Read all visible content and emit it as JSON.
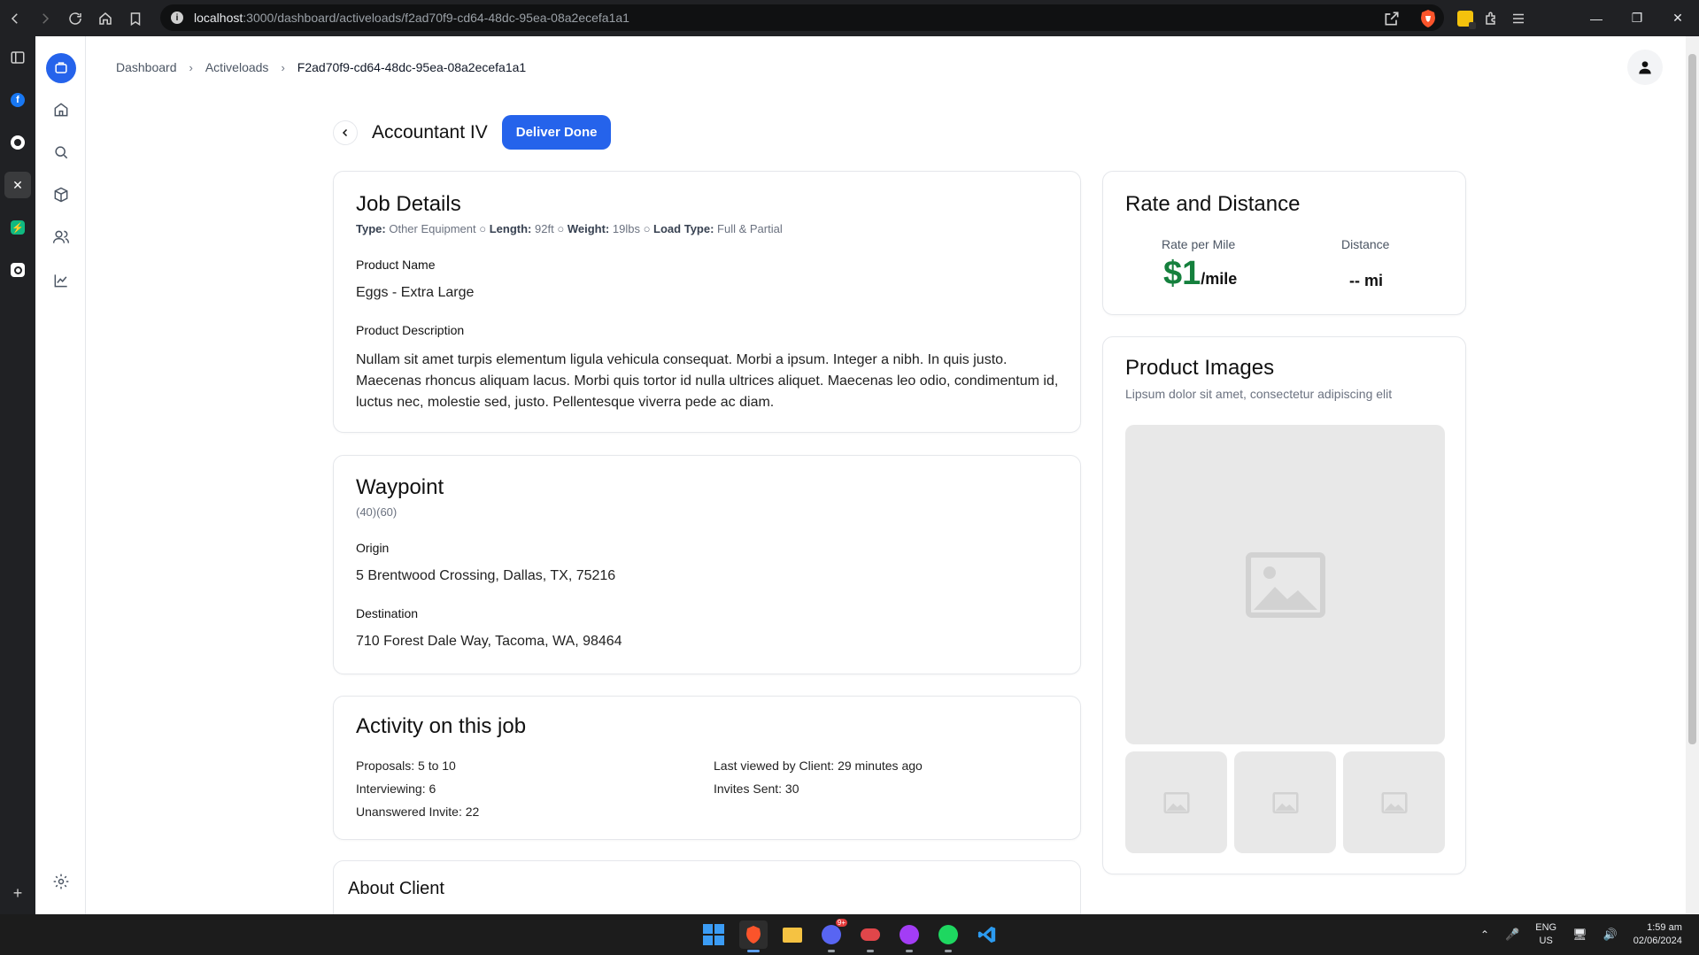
{
  "browser": {
    "url_host": "localhost",
    "url_path": ":3000/dashboard/activeloads/f2ad70f9-cd64-48dc-95ea-08a2ecefa1a1"
  },
  "breadcrumb": {
    "items": [
      "Dashboard",
      "Activeloads",
      "F2ad70f9-cd64-48dc-95ea-08a2ecefa1a1"
    ]
  },
  "header": {
    "title": "Accountant IV",
    "deliver_label": "Deliver Done"
  },
  "job_details": {
    "heading": "Job Details",
    "type_label": "Type:",
    "type_value": "Other Equipment",
    "length_label": "Length:",
    "length_value": "92ft",
    "weight_label": "Weight:",
    "weight_value": "19lbs",
    "load_type_label": "Load Type:",
    "load_type_value": "Full & Partial",
    "separator": "○",
    "product_name_label": "Product Name",
    "product_name": "Eggs - Extra Large",
    "product_description_label": "Product Description",
    "product_description": "Nullam sit amet turpis elementum ligula vehicula consequat. Morbi a ipsum. Integer a nibh. In quis justo. Maecenas rhoncus aliquam lacus. Morbi quis tortor id nulla ultrices aliquet. Maecenas leo odio, condimentum id, luctus nec, molestie sed, justo. Pellentesque viverra pede ac diam."
  },
  "waypoint": {
    "heading": "Waypoint",
    "coords": "(40)(60)",
    "origin_label": "Origin",
    "origin": "5 Brentwood Crossing, Dallas, TX, 75216",
    "destination_label": "Destination",
    "destination": "710 Forest Dale Way, Tacoma, WA, 98464"
  },
  "activity": {
    "heading": "Activity on this job",
    "proposals": "Proposals: 5 to 10",
    "interviewing": "Interviewing: 6",
    "unanswered": "Unanswered Invite: 22",
    "last_viewed": "Last viewed by Client: 29 minutes ago",
    "invites_sent": "Invites Sent: 30"
  },
  "about_client": {
    "heading": "About Client"
  },
  "rate_distance": {
    "heading": "Rate and Distance",
    "rate_label": "Rate per Mile",
    "rate_value": "$1",
    "rate_unit": "/mile",
    "distance_label": "Distance",
    "distance_value": "-- mi",
    "rate_color": "#15803d"
  },
  "product_images": {
    "heading": "Product Images",
    "subtitle": "Lipsum dolor sit amet, consectetur adipiscing elit"
  },
  "taskbar": {
    "lang": "ENG",
    "region": "US",
    "time": "1:59 am",
    "date": "02/06/2024",
    "discord_badge": "9+"
  },
  "colors": {
    "accent": "#2563eb"
  }
}
